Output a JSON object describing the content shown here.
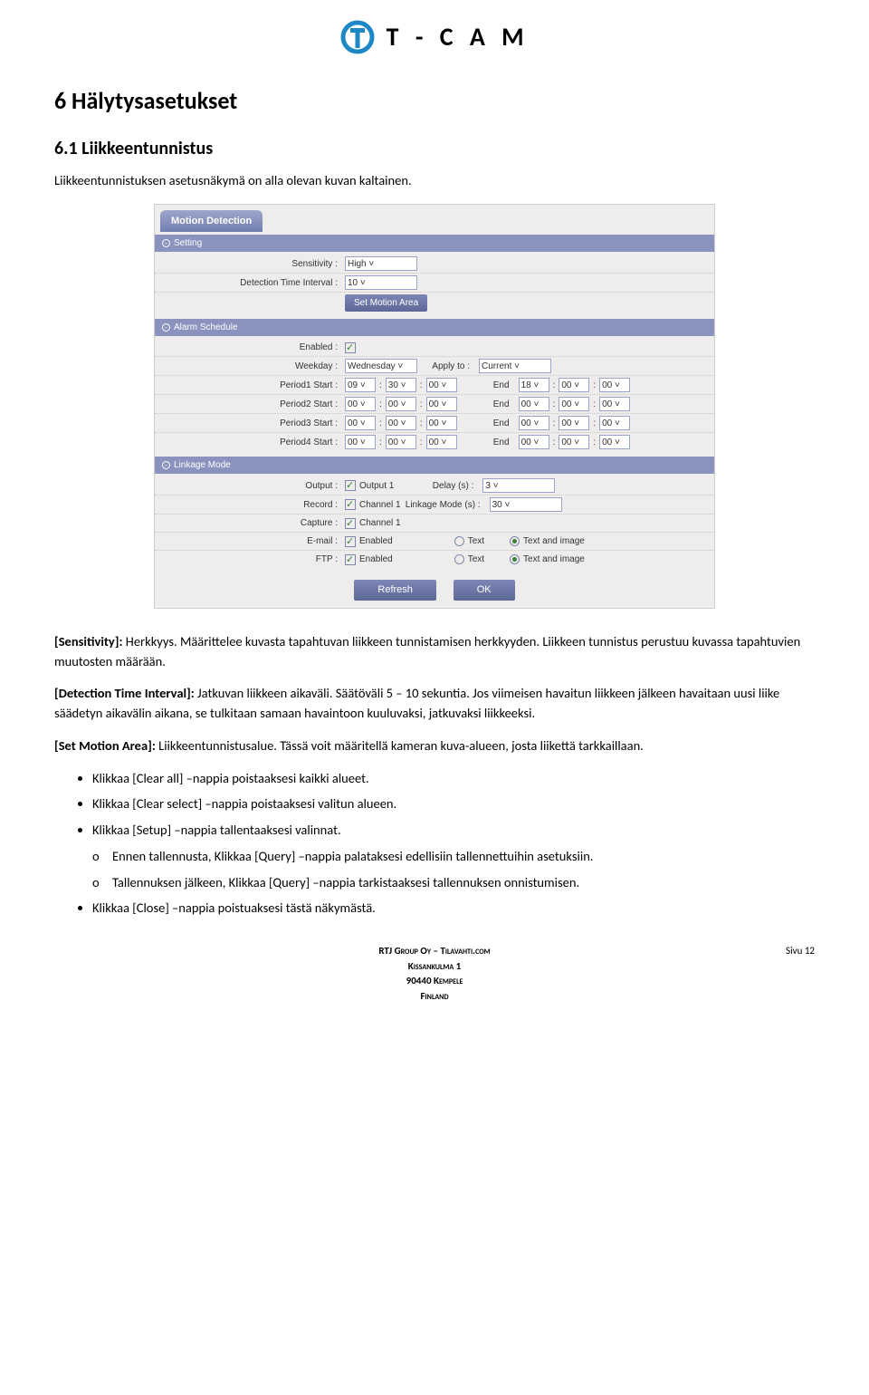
{
  "logo": {
    "brand": "T - C A M"
  },
  "headings": {
    "h1": "6  Hälytysasetukset",
    "h2": "6.1  Liikkeentunnistus"
  },
  "intro": "Liikkeentunnistuksen asetusnäkymä on alla olevan kuvan kaltainen.",
  "shot": {
    "tab": "Motion Detection",
    "sections": {
      "setting": {
        "title": "Setting",
        "sensitivity_label": "Sensitivity :",
        "sensitivity_value": "High",
        "dti_label": "Detection Time Interval :",
        "dti_value": "10",
        "set_area_btn": "Set Motion Area"
      },
      "schedule": {
        "title": "Alarm Schedule",
        "enabled_label": "Enabled :",
        "weekday_label": "Weekday :",
        "weekday_value": "Wednesday",
        "applyto_label": "Apply to :",
        "applyto_value": "Current",
        "end_label": "End",
        "periods": [
          {
            "label": "Period1 Start :",
            "sh": "09",
            "sm": "30",
            "ss": "00",
            "eh": "18",
            "em": "00",
            "es": "00"
          },
          {
            "label": "Period2 Start :",
            "sh": "00",
            "sm": "00",
            "ss": "00",
            "eh": "00",
            "em": "00",
            "es": "00"
          },
          {
            "label": "Period3 Start :",
            "sh": "00",
            "sm": "00",
            "ss": "00",
            "eh": "00",
            "em": "00",
            "es": "00"
          },
          {
            "label": "Period4 Start :",
            "sh": "00",
            "sm": "00",
            "ss": "00",
            "eh": "00",
            "em": "00",
            "es": "00"
          }
        ]
      },
      "linkage": {
        "title": "Linkage Mode",
        "output_label": "Output :",
        "output_text": "Output 1",
        "delay_label": "Delay (s) :",
        "delay_value": "3",
        "record_label": "Record :",
        "record_text": "Channel 1",
        "linkmode_label": "Linkage Mode (s) :",
        "linkmode_value": "30",
        "capture_label": "Capture :",
        "capture_text": "Channel 1",
        "email_label": "E-mail :",
        "enabled_text": "Enabled",
        "ftp_label": "FTP :",
        "radio_text": "Text",
        "radio_textimg": "Text and image"
      }
    },
    "refresh": "Refresh",
    "ok": "OK"
  },
  "body": {
    "p1_label": "[Sensitivity]:",
    "p1_text": " Herkkyys. Määrittelee kuvasta tapahtuvan liikkeen tunnistamisen herkkyyden. Liikkeen tunnistus perustuu kuvassa tapahtuvien muutosten määrään.",
    "p2_label": "[Detection Time Interval]:",
    "p2_text": " Jatkuvan liikkeen aikaväli. Säätöväli 5 – 10 sekuntia. Jos viimeisen havaitun liikkeen jälkeen havaitaan uusi liike säädetyn aikavälin aikana, se tulkitaan samaan havaintoon kuuluvaksi, jatkuvaksi liikkeeksi.",
    "p3_label": "[Set Motion Area]:",
    "p3_text": " Liikkeentunnistusalue. Tässä voit määritellä kameran kuva-alueen, josta liikettä tarkkaillaan.",
    "bullets": [
      "Klikkaa [Clear all] –nappia poistaaksesi kaikki alueet.",
      "Klikkaa [Clear select] –nappia poistaaksesi valitun alueen.",
      "Klikkaa [Setup] –nappia tallentaaksesi valinnat."
    ],
    "sub": [
      "Ennen tallennusta, Klikkaa [Query] –nappia palataksesi edellisiin tallennettuihin asetuksiin.",
      "Tallennuksen jälkeen, Klikkaa [Query] –nappia tarkistaaksesi tallennuksen onnistumisen."
    ],
    "bullet_last": "Klikkaa [Close] –nappia poistuaksesi tästä näkymästä."
  },
  "footer": {
    "l1": "RTJ Group Oy – Tilavahti.com",
    "l2": "Kissankulma 1",
    "l3": "90440 Kempele",
    "l4": "Finland",
    "page": "Sivu 12"
  }
}
